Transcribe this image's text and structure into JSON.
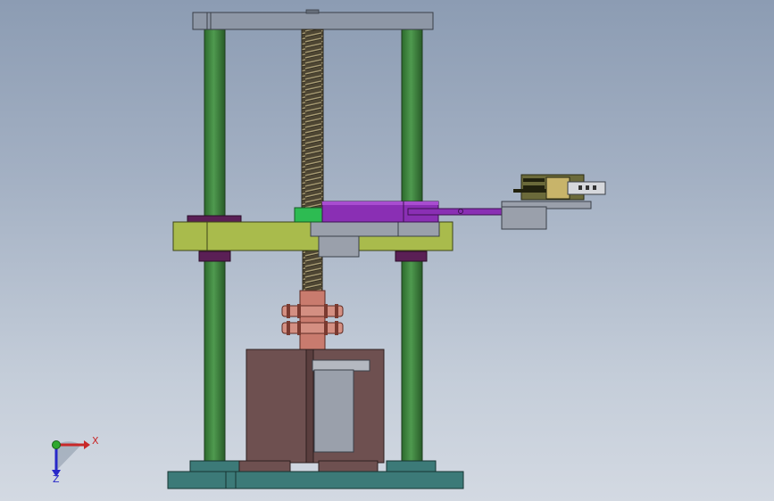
{
  "triad": {
    "x_label": "X",
    "z_label": "Z",
    "x_color": "#c82828",
    "y_color": "#2ea82e",
    "z_color": "#2828c8"
  },
  "colors": {
    "background_top": "#8c9cb3",
    "background_bottom": "#d3d9e2",
    "guide_column": "#3a7a3a",
    "top_plate": "#8e97a6",
    "lead_screw": "#5f5640",
    "carriage_plate": "#a9bb4c",
    "slide_block": "#7a2aa0",
    "coupling": "#c97b6e",
    "motor_housing": "#6e5050",
    "base_plate": "#3c7a78",
    "gripper": "#6b6a3a"
  }
}
